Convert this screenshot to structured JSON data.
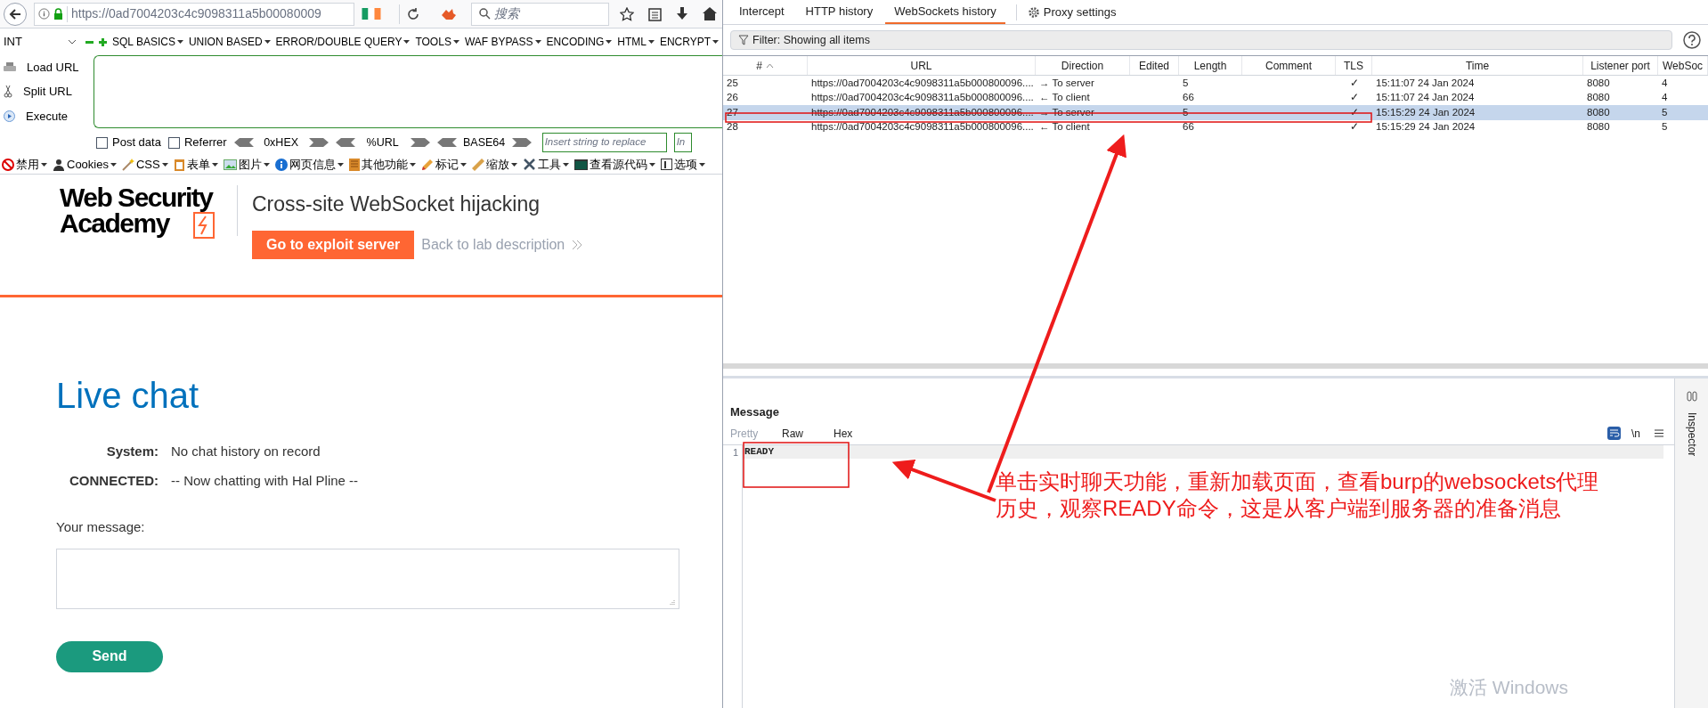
{
  "browser": {
    "url": "https://0ad7004203c4c9098311a5b00080009",
    "search_placeholder": "搜索"
  },
  "hackbar": {
    "select": "INT",
    "menus": [
      "SQL BASICS",
      "UNION BASED",
      "ERROR/DOUBLE QUERY",
      "TOOLS",
      "WAF BYPASS",
      "ENCODING",
      "HTML",
      "ENCRYPT"
    ],
    "actions": [
      "Load URL",
      "Split URL",
      "Execute"
    ],
    "options": [
      {
        "label": "Post data",
        "checked": false
      },
      {
        "label": "Referrer",
        "checked": false
      }
    ],
    "encoders": [
      "0xHEX",
      "%URL",
      "BASE64"
    ],
    "replace_placeholder": "Insert string to replace",
    "replace_with_placeholder": "In"
  },
  "toolbar": [
    {
      "label": "禁用",
      "kind": "ban"
    },
    {
      "label": "Cookies",
      "kind": "person"
    },
    {
      "label": "CSS",
      "kind": "wand"
    },
    {
      "label": "表单",
      "kind": "clipboard"
    },
    {
      "label": "图片",
      "kind": "image"
    },
    {
      "label": "网页信息",
      "kind": "info"
    },
    {
      "label": "其他功能",
      "kind": "book"
    },
    {
      "label": "标记",
      "kind": "pencil"
    },
    {
      "label": "缩放",
      "kind": "ruler"
    },
    {
      "label": "工具",
      "kind": "tools"
    },
    {
      "label": "查看源代码",
      "kind": "terminal"
    },
    {
      "label": "选项",
      "kind": "window"
    }
  ],
  "page": {
    "logo": [
      "Web Security",
      "Academy"
    ],
    "lab_title": "Cross-site WebSocket hijacking",
    "exploit_button": "Go to exploit server",
    "back_link": "Back to lab description",
    "heading": "Live chat",
    "chat": [
      {
        "sender": "System:",
        "message": "No chat history on record"
      },
      {
        "sender": "CONNECTED:",
        "message": "-- Now chatting with Hal Pline --"
      }
    ],
    "message_label": "Your message:",
    "send_button": "Send"
  },
  "burp": {
    "tabs": [
      {
        "label": "Intercept",
        "selected": false
      },
      {
        "label": "HTTP history",
        "selected": false
      },
      {
        "label": "WebSockets history",
        "selected": true
      }
    ],
    "proxy_settings": "Proxy settings",
    "filter": "Filter: Showing all items",
    "columns": [
      "#",
      "URL",
      "Direction",
      "Edited",
      "Length",
      "Comment",
      "TLS",
      "Time",
      "Listener port",
      "WebSoc"
    ],
    "rows": [
      {
        "number": "25",
        "url": "https://0ad7004203c4c9098311a5b000800096....",
        "direction": "→ To server",
        "length": "5",
        "tls": "✓",
        "time": "15:11:07 24 Jan 2024",
        "port": "8080",
        "websocket_id": "4",
        "selected": false
      },
      {
        "number": "26",
        "url": "https://0ad7004203c4c9098311a5b000800096....",
        "direction": "← To client",
        "length": "66",
        "tls": "✓",
        "time": "15:11:07 24 Jan 2024",
        "port": "8080",
        "websocket_id": "4",
        "selected": false
      },
      {
        "number": "27",
        "url": "https://0ad7004203c4c9098311a5b000800096....",
        "direction": "→ To server",
        "length": "5",
        "tls": "✓",
        "time": "15:15:29 24 Jan 2024",
        "port": "8080",
        "websocket_id": "5",
        "selected": true
      },
      {
        "number": "28",
        "url": "https://0ad7004203c4c9098311a5b000800096....",
        "direction": "← To client",
        "length": "66",
        "tls": "✓",
        "time": "15:15:29 24 Jan 2024",
        "port": "8080",
        "websocket_id": "5",
        "selected": false
      }
    ],
    "message": {
      "title": "Message",
      "tabs": [
        {
          "label": "Pretty",
          "disabled": true
        },
        {
          "label": "Raw",
          "disabled": false
        },
        {
          "label": "Hex",
          "disabled": false
        }
      ],
      "newline_toggle": "\\n",
      "lines": [
        {
          "number": "1",
          "text": "READY"
        }
      ]
    },
    "inspector": "Inspector"
  },
  "annotation": {
    "text": "单击实时聊天功能，重新加载页面，查看burp的websockets代理历史，观察READY命令，这是从客户端到服务器的准备消息"
  },
  "os_notice": "激活 Windows"
}
